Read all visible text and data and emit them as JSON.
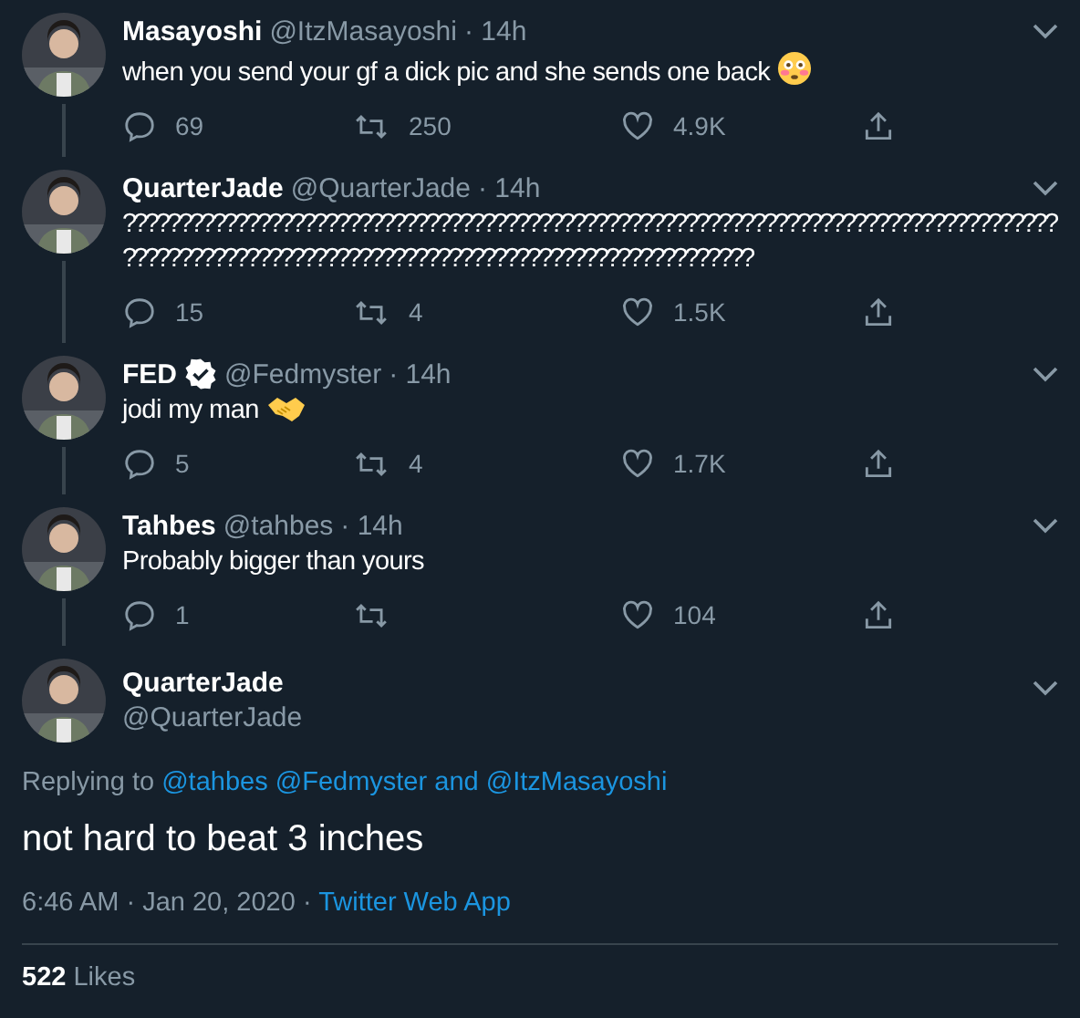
{
  "replies": [
    {
      "name": "Masayoshi",
      "verified": false,
      "handle": "@ItzMasayoshi",
      "time": "· 14h",
      "text": "when you send your gf a dick pic and she sends one back",
      "kind": "face",
      "thread_line": true,
      "reply_count": "69",
      "retweet_count": "250",
      "like_count": "4.9K"
    },
    {
      "name": "QuarterJade",
      "verified": false,
      "handle": "@QuarterJade",
      "time": "· 14h",
      "kind": "dense",
      "text": "???????????????????????????????????????????????????????????????????????????????????????????????????????????????????????????????????????????",
      "thread_line": true,
      "reply_count": "15",
      "retweet_count": "4",
      "like_count": "1.5K"
    },
    {
      "name": "FED",
      "verified": true,
      "handle": "@Fedmyster",
      "time": "· 14h",
      "text": "jodi my man",
      "kind": "hands",
      "thread_line": true,
      "reply_count": "5",
      "retweet_count": "4",
      "like_count": "1.7K"
    },
    {
      "name": "Tahbes",
      "verified": false,
      "handle": "@tahbes",
      "time": "· 14h",
      "kind": "plain",
      "text": "Probably bigger than yours",
      "thread_line": true,
      "reply_count": "1",
      "like_count": "104"
    }
  ],
  "main_tweet": {
    "name": "QuarterJade",
    "handle": "@QuarterJade",
    "replying_to": [
      {
        "kind": "plain",
        "text": "Replying to"
      },
      {
        "kind": "link",
        "text": "@tahbes"
      },
      {
        "kind": "link",
        "text": "@Fedmyster"
      },
      {
        "kind": "link",
        "text": "and"
      },
      {
        "kind": "link",
        "text": "@ItzMasayoshi"
      }
    ],
    "text": "not hard to beat 3 inches",
    "timestamp": "6:46 AM · Jan 20, 2020 ·",
    "source": "Twitter Web App",
    "likes_count": "522",
    "likes_label": "Likes"
  }
}
